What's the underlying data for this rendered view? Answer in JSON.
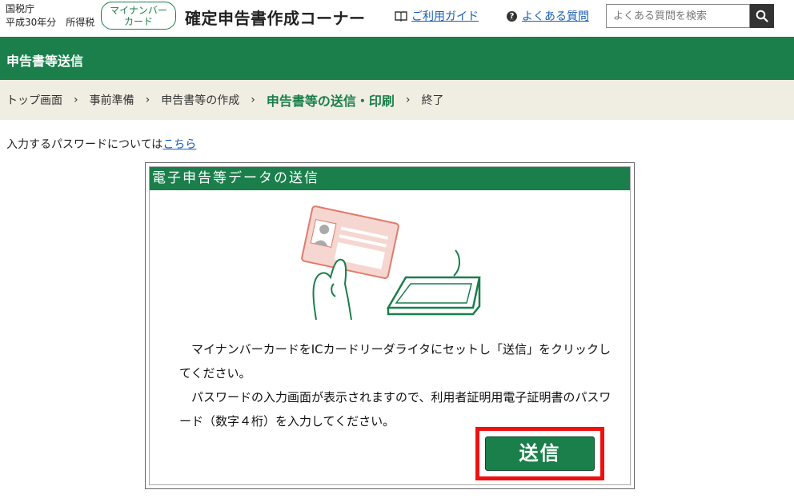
{
  "header": {
    "agency": "国税庁",
    "tax_year": "平成30年分　所得税",
    "mynumber_badge": "マイナンバーカード",
    "mynumber_badge_line1": "マイナンバー",
    "mynumber_badge_line2": "カード",
    "site_title": "確定申告書作成コーナー",
    "guide_link": "ご利用ガイド",
    "guide_icon": "book-icon",
    "faq_link": "よくある質問",
    "faq_icon": "question-circle-icon",
    "search_placeholder": "よくある質問を検索",
    "search_icon": "search-icon"
  },
  "section_title": "申告書等送信",
  "breadcrumb": {
    "items": [
      "トップ画面",
      "事前準備",
      "申告書等の作成",
      "申告書等の送信・印刷",
      "終了"
    ],
    "current_index": 3
  },
  "password_note": {
    "text": "入力するパスワードについては",
    "link": "こちら"
  },
  "panel": {
    "title": "電子申告等データの送信",
    "illustration": "mynumber-card-and-ic-reader",
    "instruction_1": "マイナンバーカードをICカードリーダライタにセットし「送信」をクリックしてください。",
    "instruction_2": "パスワードの入力画面が表示されますので、利用者証明用電子証明書のパスワード（数字４桁）を入力してください。",
    "send_button": "送信"
  },
  "colors": {
    "brand_green": "#1a7f4b",
    "breadcrumb_bg": "#f0ede2",
    "link_blue": "#1a5fb4",
    "highlight_red": "#ee1111"
  }
}
